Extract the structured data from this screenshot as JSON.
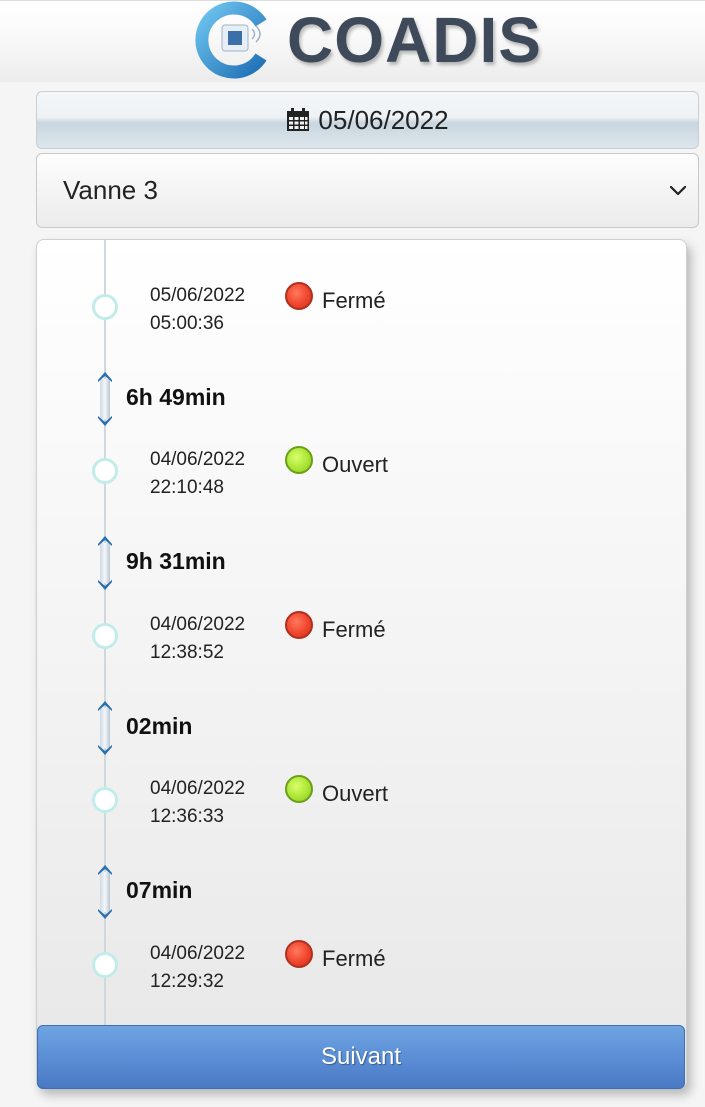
{
  "header": {
    "brand": "COADIS"
  },
  "date_picker": {
    "label": "05/06/2022",
    "icon": "calendar-icon"
  },
  "valve_select": {
    "value": "Vanne 3",
    "icon": "chevron-down-icon"
  },
  "timeline": {
    "events": [
      {
        "date": "05/06/2022",
        "time": "05:00:36",
        "status": "Fermé",
        "state": "closed",
        "color": "#f0452c"
      },
      {
        "date": "04/06/2022",
        "time": "22:10:48",
        "status": "Ouvert",
        "state": "open",
        "color": "#a8e233"
      },
      {
        "date": "04/06/2022",
        "time": "12:38:52",
        "status": "Fermé",
        "state": "closed",
        "color": "#f0452c"
      },
      {
        "date": "04/06/2022",
        "time": "12:36:33",
        "status": "Ouvert",
        "state": "open",
        "color": "#a8e233"
      },
      {
        "date": "04/06/2022",
        "time": "12:29:32",
        "status": "Fermé",
        "state": "closed",
        "color": "#f0452c"
      }
    ],
    "durations": [
      {
        "text": "6h 49min"
      },
      {
        "text": "9h 31min"
      },
      {
        "text": "02min"
      },
      {
        "text": "07min"
      }
    ]
  },
  "footer": {
    "next_label": "Suivant"
  },
  "colors": {
    "accent": "#5b8fd6",
    "brand_text": "#3e4a5a",
    "logo_blue": "#2a8fd4"
  }
}
